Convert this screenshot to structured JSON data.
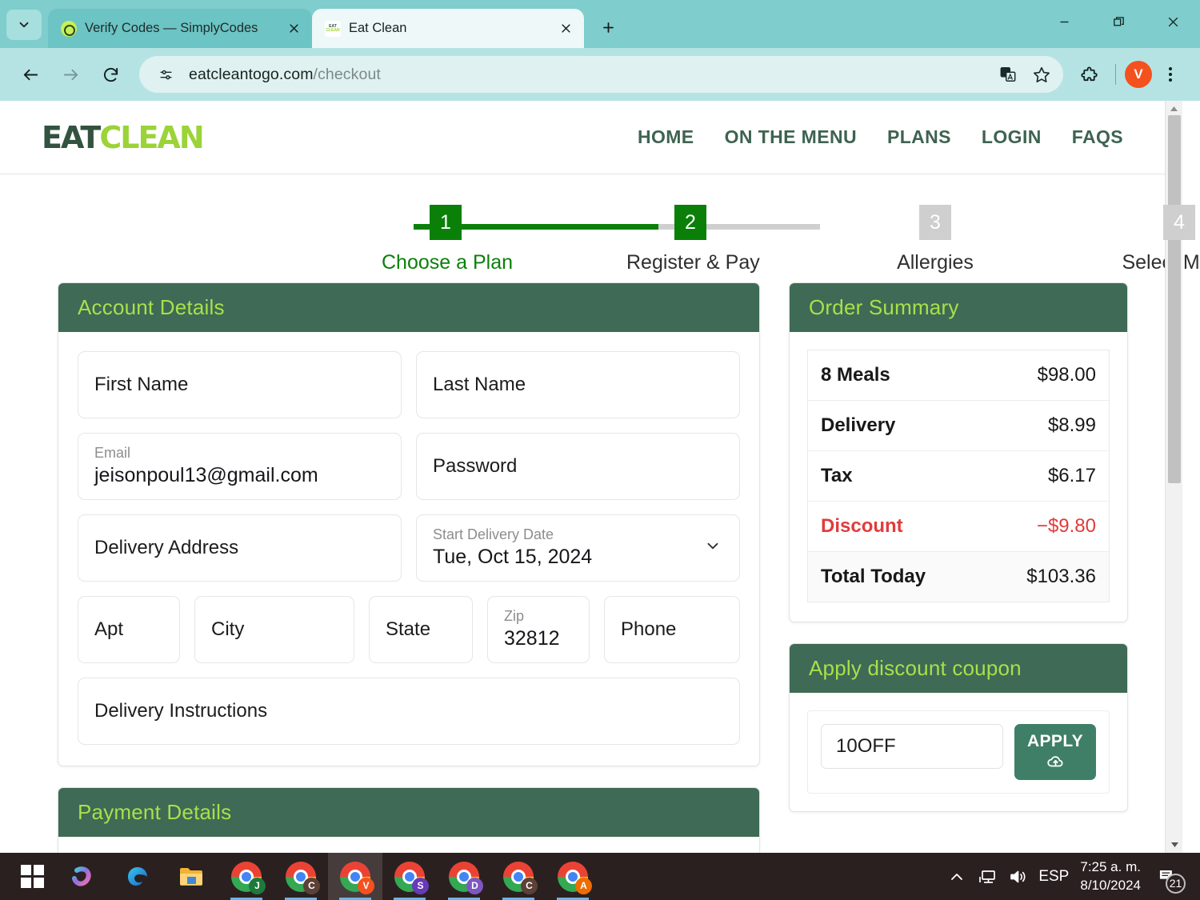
{
  "browser": {
    "tabs": [
      {
        "title": "Verify Codes — SimplyCodes",
        "favicon": "simplycodes-icon",
        "active": false
      },
      {
        "title": "Eat Clean",
        "favicon": "eatclean-icon",
        "active": true
      }
    ],
    "favicon_eat_text": {
      "line1": "EAT",
      "line2": "CLEAN"
    },
    "url": {
      "domain": "eatcleantogo.com",
      "path": "/checkout"
    },
    "profile_initial": "V",
    "icons": {
      "back": "back-arrow-icon",
      "forward": "forward-arrow-icon",
      "reload": "reload-icon",
      "site_info": "site-settings-icon",
      "translate": "translate-icon",
      "bookmark": "star-icon",
      "extensions": "extensions-puzzle-icon",
      "menu": "three-dot-menu-icon",
      "minimize": "minimize-icon",
      "restore": "restore-icon",
      "close": "close-icon",
      "new_tab": "new-tab-plus-icon",
      "tab_search": "tab-search-chevron-icon"
    }
  },
  "site": {
    "logo": {
      "part1": "EAT",
      "part2": "CLEAN"
    },
    "nav": [
      {
        "label": "HOME"
      },
      {
        "label": "ON THE MENU"
      },
      {
        "label": "PLANS"
      },
      {
        "label": "LOGIN"
      },
      {
        "label": "FAQS"
      }
    ]
  },
  "stepper": {
    "steps": [
      {
        "number": "1",
        "label": "Choose a Plan",
        "state": "done"
      },
      {
        "number": "2",
        "label": "Register & Pay",
        "state": "current"
      },
      {
        "number": "3",
        "label": "Allergies",
        "state": "todo"
      },
      {
        "number": "4",
        "label": "Select Meals",
        "state": "todo"
      }
    ]
  },
  "account_details": {
    "title": "Account Details",
    "first_name": {
      "placeholder": "First Name",
      "value": ""
    },
    "last_name": {
      "placeholder": "Last Name",
      "value": ""
    },
    "email": {
      "label": "Email",
      "value": "jeisonpoul13@gmail.com"
    },
    "password": {
      "placeholder": "Password",
      "value": ""
    },
    "delivery_address": {
      "placeholder": "Delivery Address",
      "value": ""
    },
    "start_delivery_date": {
      "label": "Start Delivery Date",
      "value": "Tue, Oct 15, 2024"
    },
    "apt": {
      "placeholder": "Apt",
      "value": ""
    },
    "city": {
      "placeholder": "City",
      "value": ""
    },
    "state": {
      "placeholder": "State",
      "value": ""
    },
    "zip": {
      "label": "Zip",
      "value": "32812"
    },
    "phone": {
      "placeholder": "Phone",
      "value": ""
    },
    "delivery_instructions": {
      "placeholder": "Delivery Instructions",
      "value": ""
    }
  },
  "payment_details": {
    "title": "Payment Details"
  },
  "order_summary": {
    "title": "Order Summary",
    "rows": [
      {
        "label": "8 Meals",
        "amount": "$98.00",
        "kind": "normal"
      },
      {
        "label": "Delivery",
        "amount": "$8.99",
        "kind": "normal"
      },
      {
        "label": "Tax",
        "amount": "$6.17",
        "kind": "normal"
      },
      {
        "label": "Discount",
        "amount": "−$9.80",
        "kind": "discount"
      },
      {
        "label": "Total Today",
        "amount": "$103.36",
        "kind": "total"
      }
    ]
  },
  "coupon": {
    "title": "Apply discount coupon",
    "code_value": "10OFF",
    "apply_label": "APPLY",
    "apply_icon": "cloud-upload-icon"
  },
  "taskbar": {
    "start_icon": "windows-start-icon",
    "pinned": [
      {
        "name": "copilot-icon",
        "type": "copilot"
      },
      {
        "name": "edge-icon",
        "type": "edge"
      },
      {
        "name": "file-explorer-icon",
        "type": "explorer"
      }
    ],
    "chrome_windows": [
      {
        "badge": "J",
        "badge_color": "#1e7a3c",
        "active": false
      },
      {
        "badge": "C",
        "badge_color": "#5d4037",
        "active": false
      },
      {
        "badge": "V",
        "badge_color": "#f4511e",
        "active": true
      },
      {
        "badge": "S",
        "badge_color": "#673ab7",
        "active": false
      },
      {
        "badge": "D",
        "badge_color": "#7e57c2",
        "active": false
      },
      {
        "badge": "C",
        "badge_color": "#5d4037",
        "active": false
      },
      {
        "badge": "A",
        "badge_color": "#ef6c00",
        "active": false
      }
    ],
    "tray": {
      "overflow_icon": "chevron-up-icon",
      "network_icon": "network-monitor-icon",
      "volume_icon": "volume-icon",
      "language": "ESP",
      "time": "7:25 a. m.",
      "date": "8/10/2024",
      "notifications_icon": "notifications-icon",
      "notifications_count": "21"
    }
  },
  "colors": {
    "brand_green": "#3f6a55",
    "brand_lime": "#a8e04b",
    "step_green": "#0a8009",
    "discount_red": "#e23b3b",
    "apply_green": "#3f7f68"
  }
}
